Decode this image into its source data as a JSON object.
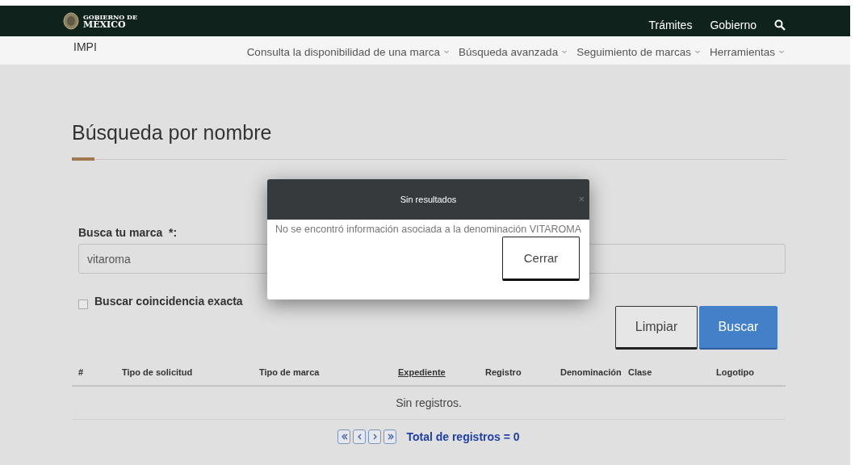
{
  "header": {
    "logo": {
      "line_1": "GOBIERNO DE",
      "line_2": "MÉXICO"
    },
    "links": [
      "Trámites",
      "Gobierno"
    ]
  },
  "subnav": {
    "brand": "IMPI",
    "items": [
      "Consulta la disponibilidad de una marca",
      "Búsqueda avanzada",
      "Seguimiento de marcas",
      "Herramientas"
    ]
  },
  "page": {
    "title": "Búsqueda por nombre"
  },
  "form": {
    "label": "Busca tu marca",
    "required_mark": "*:",
    "value": "vitaroma",
    "checkbox": {
      "label": "Buscar coincidencia exacta",
      "checked": false
    },
    "buttons": [
      {
        "label": "Limpiar",
        "kind": "secondary"
      },
      {
        "label": "Buscar",
        "kind": "primary"
      }
    ]
  },
  "table": {
    "columns": [
      {
        "label": "#",
        "sorted": false
      },
      {
        "label": "Tipo de solicitud",
        "sorted": false
      },
      {
        "label": "Tipo de marca",
        "sorted": false
      },
      {
        "label": "Expediente",
        "sorted": true
      },
      {
        "label": "Registro",
        "sorted": false
      },
      {
        "label": "Denominación",
        "sorted": false
      },
      {
        "label": "Clase",
        "sorted": false
      },
      {
        "label": "Logotipo",
        "sorted": false
      }
    ],
    "empty_message": "Sin registros."
  },
  "pagination": {
    "buttons": [
      {
        "kind": "first"
      },
      {
        "kind": "previous"
      },
      {
        "kind": "next"
      },
      {
        "kind": "last"
      }
    ],
    "total": "Total de registros = 0"
  },
  "modal": {
    "title": "Sin resultados",
    "close": "×",
    "message": "No se encontró información asociada a la denominación VITAROMA",
    "button": "Cerrar"
  }
}
